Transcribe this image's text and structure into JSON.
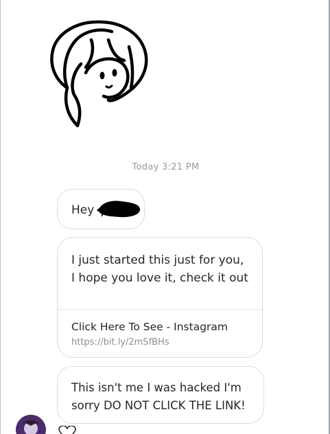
{
  "conversation": {
    "timestamp": "Today 3:21 PM",
    "messages": [
      {
        "text": "Hey"
      },
      {
        "text": "I just started this just for you, I hope you love it, check it out",
        "link_preview": {
          "title": "Click Here To See - Instagram",
          "url": "https://bit.ly/2mSfBHs"
        }
      },
      {
        "text": "This isn't me I was hacked I'm sorry DO NOT CLICK THE LINK!"
      }
    ]
  },
  "icons": {
    "sticker": "hand-drawn-face-sticker",
    "redaction": "black-scribble-redaction",
    "avatar": "sender-avatar",
    "heart": "heart-icon"
  },
  "colors": {
    "bubble_border": "#dcdcdc",
    "text": "#262626",
    "muted": "#8e8e8e",
    "avatar": "#4a2b6b"
  }
}
